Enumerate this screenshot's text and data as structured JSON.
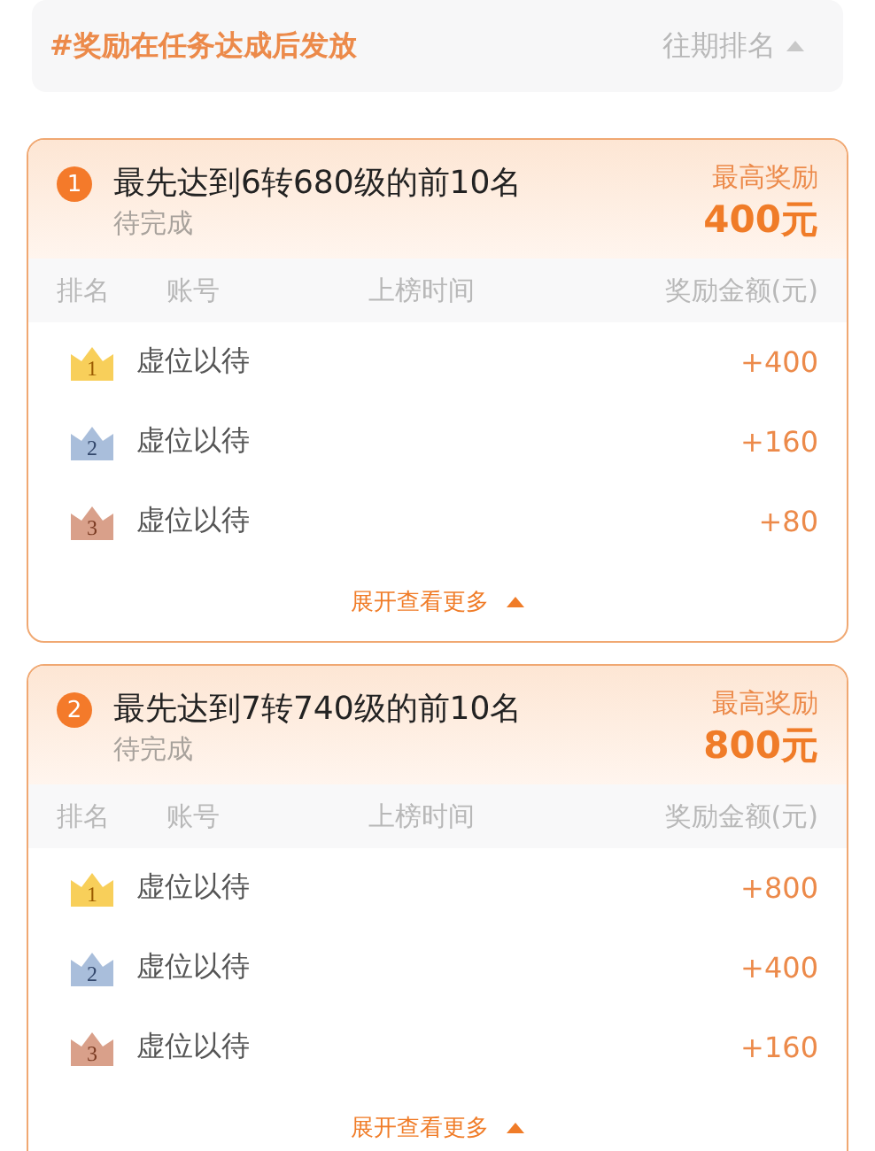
{
  "notice": {
    "text": "#奖励在任务达成后发放",
    "history_link": "往期排名"
  },
  "tasks": [
    {
      "index": "1",
      "title": "最先达到6转680级的前10名",
      "status": "待完成",
      "reward_label": "最高奖励",
      "reward_amount": "400元",
      "columns": [
        "排名",
        "账号",
        "上榜时间",
        "奖励金额(元)"
      ],
      "rows": [
        {
          "rank": "1",
          "kind": "gold",
          "account": "虚位以待",
          "amount": "+400"
        },
        {
          "rank": "2",
          "kind": "silver",
          "account": "虚位以待",
          "amount": "+160"
        },
        {
          "rank": "3",
          "kind": "bronze",
          "account": "虚位以待",
          "amount": "+80"
        }
      ],
      "expand": "展开查看更多"
    },
    {
      "index": "2",
      "title": "最先达到7转740级的前10名",
      "status": "待完成",
      "reward_label": "最高奖励",
      "reward_amount": "800元",
      "columns": [
        "排名",
        "账号",
        "上榜时间",
        "奖励金额(元)"
      ],
      "rows": [
        {
          "rank": "1",
          "kind": "gold",
          "account": "虚位以待",
          "amount": "+800"
        },
        {
          "rank": "2",
          "kind": "silver",
          "account": "虚位以待",
          "amount": "+400"
        },
        {
          "rank": "3",
          "kind": "bronze",
          "account": "虚位以待",
          "amount": "+160"
        }
      ],
      "expand": "展开查看更多"
    }
  ]
}
